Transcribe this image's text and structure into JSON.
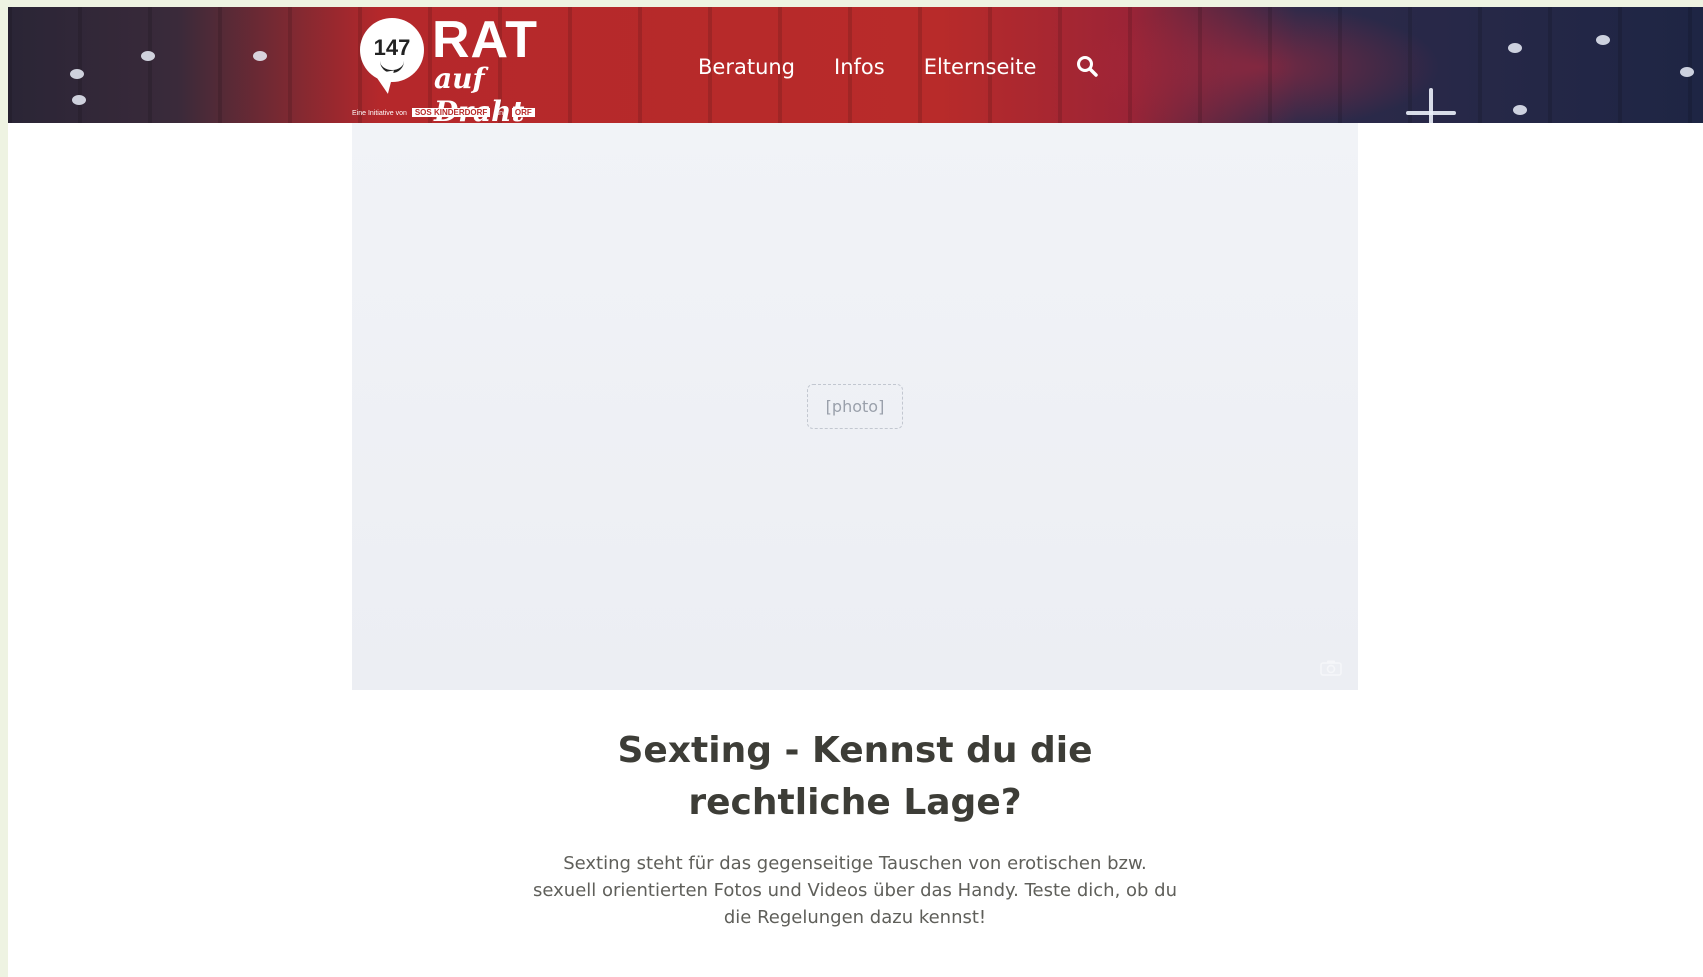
{
  "header": {
    "logo": {
      "number": "147",
      "name_line1": "RAT",
      "name_line2": "auf Draht",
      "tagline_prefix": "Eine Initiative von",
      "partner1": "SOS KINDERDORF",
      "tagline_and": "und",
      "partner2": "ORF"
    },
    "nav": [
      {
        "label": "Beratung"
      },
      {
        "label": "Infos"
      },
      {
        "label": "Elternseite"
      }
    ],
    "search_icon": "search-icon",
    "brand_color": "#b82b2a"
  },
  "hero": {
    "icon": "camera-icon"
  },
  "article": {
    "title_line1": "Sexting - Kennst du die",
    "title_line2": "rechtliche Lage?",
    "intro": "Sexting steht für das gegenseitige Tauschen von erotischen bzw. sexuell orientierten Fotos und Videos über das Handy. Teste dich, ob du die Regelungen dazu kennst!"
  }
}
